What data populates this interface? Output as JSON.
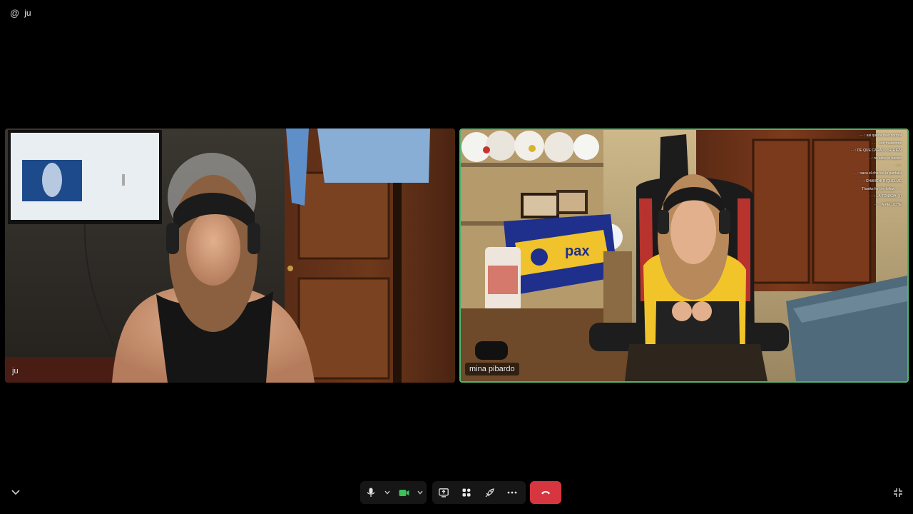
{
  "header": {
    "icon": "at-icon",
    "user_name": "ju"
  },
  "participants": [
    {
      "name": "ju",
      "active_speaker": false
    },
    {
      "name": "mina pibardo",
      "active_speaker": true
    }
  ],
  "stream_overlay": {
    "brand_text": "pax"
  },
  "chat_overlay": [
    {
      "user": "·····",
      "text": ": asi queda mas normal"
    },
    {
      "user": "·····",
      "text": ": son malisimos"
    },
    {
      "user": "·····",
      "text": ": DE QUE CARAJO SE RIEN"
    },
    {
      "user": "·····",
      "text": ": no sabe el basico"
    },
    {
      "user": "·····",
      "text": ""
    },
    {
      "user": "·····",
      "text": ": saca el chat de la pantalla"
    },
    {
      "user": "",
      "text": ""
    },
    {
      "user": "·····",
      "text": ": CHANCHI RIQUELME"
    },
    {
      "user": "",
      "text": "Thanks for the follow ·····"
    },
    {
      "user": "·····",
      "text": ": LA TONADA :)))"
    },
    {
      "user": "",
      "text": ""
    },
    {
      "user": "·····",
      "text": ": A PELUCHE"
    }
  ],
  "controls": {
    "mic_icon": "microphone-icon",
    "camera_icon": "video-camera-icon",
    "accent_green": "#3fbf5a",
    "hangup_color": "#d5363f"
  }
}
